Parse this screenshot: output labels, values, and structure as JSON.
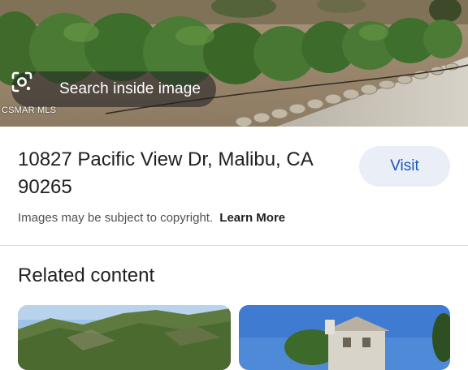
{
  "image_preview": {
    "lens_button_label": "Search inside image",
    "credit": "CSMAR MLS"
  },
  "result": {
    "title": "10827 Pacific View Dr, Malibu, CA 90265",
    "visit_label": "Visit",
    "copyright_notice": "Images may be subject to copyright.",
    "learn_more_label": "Learn More"
  },
  "related": {
    "heading": "Related content"
  },
  "colors": {
    "visit_button_bg": "#e9eef7",
    "visit_button_text": "#1a56b8",
    "text_primary": "#202124",
    "text_secondary": "#4d5156"
  },
  "icons": {
    "lens": "google-lens-icon"
  }
}
